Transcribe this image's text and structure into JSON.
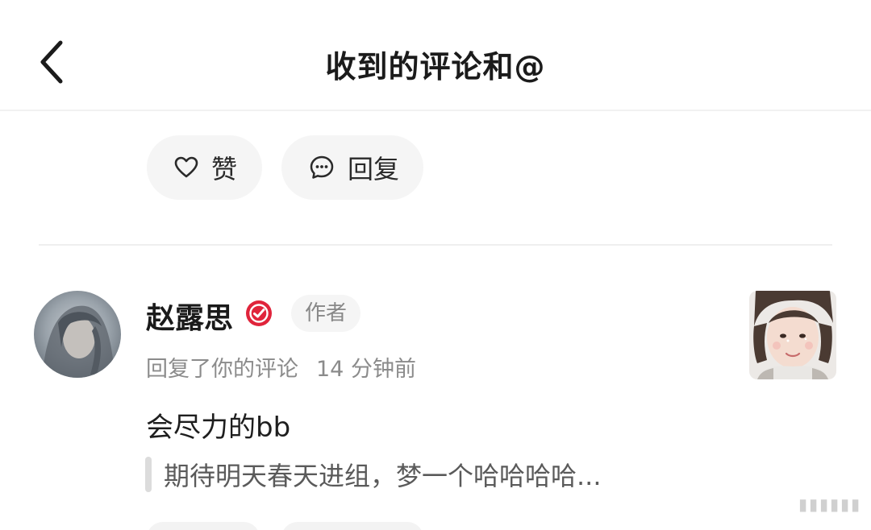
{
  "header": {
    "title": "收到的评论和@",
    "back_icon": "chevron-left-icon"
  },
  "prev_item_actions": {
    "like_label": "赞",
    "like_icon": "heart-outline-icon",
    "reply_label": "回复",
    "reply_icon": "comment-bubble-icon"
  },
  "notification": {
    "username": "赵露思",
    "verified_icon": "verified-check-icon",
    "verified_color": "#e0243b",
    "author_tag": "作者",
    "action_text": "回复了你的评论",
    "time": "14 分钟前",
    "comment": "会尽力的bb",
    "quoted_comment": "期待明天春天进组，梦一个哈哈哈哈..."
  }
}
